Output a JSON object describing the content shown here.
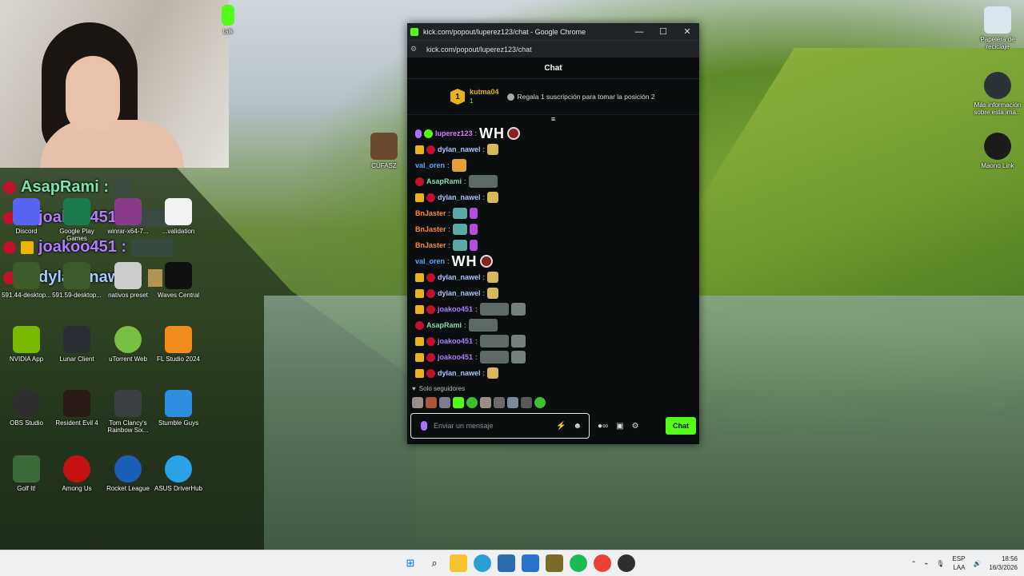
{
  "webcam_overlay": {
    "messages": [
      {
        "user": "AsapRami :",
        "color": "#7fe0b0"
      },
      {
        "user": "joakoo451 :",
        "color": "#b07cff"
      },
      {
        "user": "joakoo451 :",
        "color": "#b07cff"
      },
      {
        "user": "dylan_nawel :",
        "color": "#a7c7ff"
      }
    ]
  },
  "desktop_icons": [
    "Discord",
    "Google Play Games",
    "winrar-x64-7...",
    "...validation",
    "591.44-desktop...",
    "591.59-desktop...",
    "nativos preset",
    "Waves Central",
    "NVIDIA App",
    "Lunar Client",
    "uTorrent Web",
    "FL Studio 2024",
    "OBS Studio",
    "Resident Evil 4",
    "Tom Clancy's Rainbow Six...",
    "Stumble Guys",
    "Golf It!",
    "Among Us",
    "Rocket League",
    "ASUS DriverHub",
    "CUFASZ",
    "Papelera de reciclaje",
    "Más información sobre esta ima...",
    "Maono Link",
    "talk"
  ],
  "browser": {
    "title": "kick.com/popout/luperez123/chat - Google Chrome",
    "url": "kick.com/popout/luperez123/chat",
    "controls": {
      "minimize": "—",
      "maximize": "☐",
      "close": "✕"
    }
  },
  "chat": {
    "header": "Chat",
    "pinned": {
      "rank": "1",
      "user": "kutma04",
      "count": "1",
      "gift_text": "Regala 1 suscripción para tomar la posición 2"
    },
    "messages": [
      {
        "user": "luperez123",
        "color": "#d77cff",
        "kind": "text",
        "text": "WH"
      },
      {
        "user": "dylan_nawel",
        "color": "#a7c7ff",
        "kind": "emote"
      },
      {
        "user": "val_oren",
        "color": "#5aa9ff",
        "kind": "emote"
      },
      {
        "user": "AsapRami",
        "color": "#7fe0b0",
        "kind": "emote"
      },
      {
        "user": "dylan_nawel",
        "color": "#a7c7ff",
        "kind": "emote"
      },
      {
        "user": "BnJaster",
        "color": "#ff8a33",
        "kind": "emote"
      },
      {
        "user": "BnJaster",
        "color": "#ff8a33",
        "kind": "emote"
      },
      {
        "user": "BnJaster",
        "color": "#ff8a33",
        "kind": "emote"
      },
      {
        "user": "val_oren",
        "color": "#5aa9ff",
        "kind": "text",
        "text": "WH"
      },
      {
        "user": "dylan_nawel",
        "color": "#a7c7ff",
        "kind": "emote"
      },
      {
        "user": "dylan_nawel",
        "color": "#a7c7ff",
        "kind": "emote"
      },
      {
        "user": "joakoo451",
        "color": "#b07cff",
        "kind": "emote"
      },
      {
        "user": "AsapRami",
        "color": "#7fe0b0",
        "kind": "emote"
      },
      {
        "user": "joakoo451",
        "color": "#b07cff",
        "kind": "emote"
      },
      {
        "user": "joakoo451",
        "color": "#b07cff",
        "kind": "emote"
      },
      {
        "user": "dylan_nawel",
        "color": "#a7c7ff",
        "kind": "emote"
      }
    ],
    "followers_only": "Solo seguidores",
    "input_placeholder": "Enviar un mensaje",
    "send_label": "Chat"
  },
  "taskbar": {
    "lang": "ESP",
    "lang2": "LAA",
    "time": "18:56",
    "date": "16/3/2026"
  },
  "colors": {
    "accent": "#53fc18",
    "gold": "#e9b21d"
  }
}
